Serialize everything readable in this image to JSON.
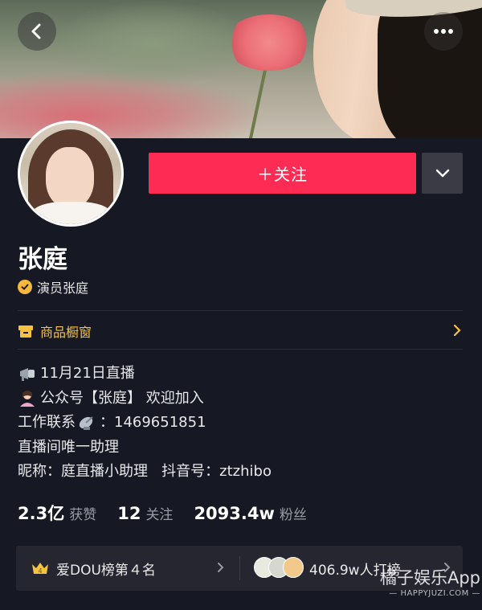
{
  "header": {
    "back_icon": "chevron-left-icon",
    "more_icon": "more-dots-icon"
  },
  "profile": {
    "name": "张庭",
    "verified_text": "演员张庭",
    "follow_label": "＋关注"
  },
  "shop": {
    "label": "商品橱窗"
  },
  "bio": [
    "11月21日直播",
    "公众号【张庭】 欢迎加入",
    "工作联系",
    "：1469651851",
    "直播间唯一助理",
    "昵称：庭直播小助理   抖音号：ztzhibo"
  ],
  "stats": [
    {
      "value": "2.3亿",
      "label": "获赞"
    },
    {
      "value": "12",
      "label": "关注"
    },
    {
      "value": "2093.4w",
      "label": "粉丝"
    }
  ],
  "rank": {
    "badge_number": "4",
    "text": "爱DOU榜第４名",
    "fan_text": "406.9w人打榜"
  },
  "watermark": {
    "main": "橘子娱乐App",
    "sub": "— HAPPYJUZI.COM —"
  },
  "colors": {
    "background": "#161823",
    "follow": "#fe2c55",
    "shop": "#f6c340",
    "verify": "#f6b73c"
  }
}
